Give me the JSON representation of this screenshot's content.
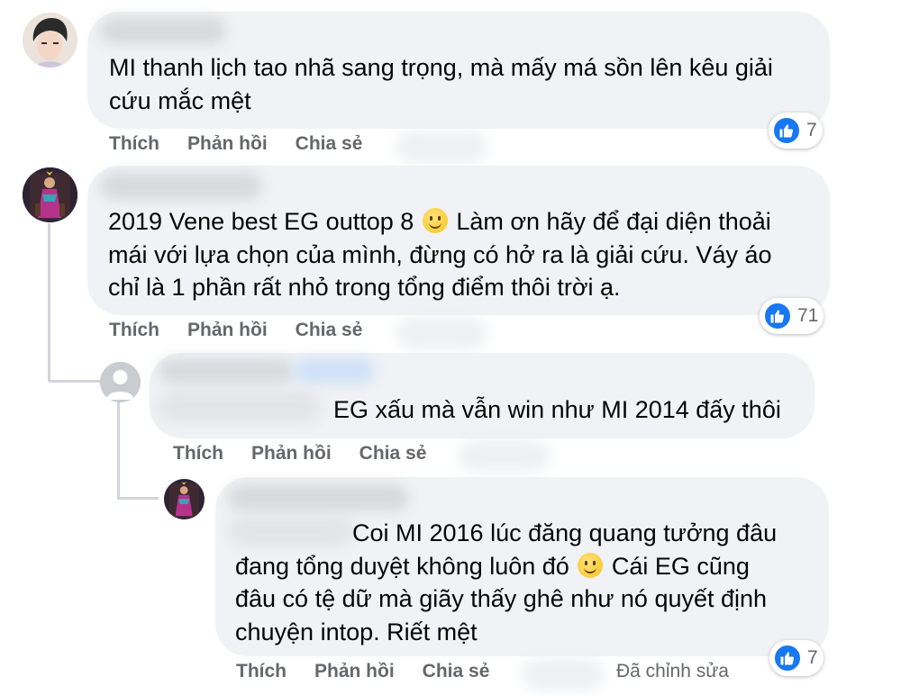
{
  "actions": {
    "like": "Thích",
    "reply": "Phản hồi",
    "share": "Chia sẻ"
  },
  "comments": [
    {
      "lines": [
        "MI thanh lịch tao nhã sang trọng, mà mấy má sồn lên kêu giải",
        "cứu mắc mệt"
      ],
      "reactions": "7"
    },
    {
      "line1_pre": "2019 Vene best EG outtop 8",
      "line1_post": "Làm ơn hãy để đại diện thoải",
      "lines": [
        "mái với lựa chọn của mình, đừng có hở ra là giải cứu. Váy áo",
        "chỉ là 1 phần rất nhỏ trong tổng điểm thôi trời ạ."
      ],
      "reactions": "71"
    },
    {
      "lines": [
        "EG xấu mà vẫn win như MI 2014 đấy thôi"
      ]
    },
    {
      "line1": "Coi MI 2016 lúc đăng quang tưởng đâu",
      "line2_pre": "đang tổng duyệt không luôn đó",
      "line2_post": "Cái EG cũng",
      "lines": [
        "đâu có tệ dữ mà giãy thấy ghê như nó quyết định",
        "chuyện intop. Riết mệt"
      ],
      "reactions": "7",
      "edited": "Đã chỉnh sửa"
    }
  ],
  "icons": {
    "like_badge": "thumbs-up-icon",
    "emoji": "smiling-face-icon",
    "default_avatar": "default-avatar-icon"
  },
  "colors": {
    "bubble": "#f0f2f5",
    "action_text": "#65676b",
    "like_blue": "#1877f2",
    "thread_line": "#d2d5da"
  }
}
